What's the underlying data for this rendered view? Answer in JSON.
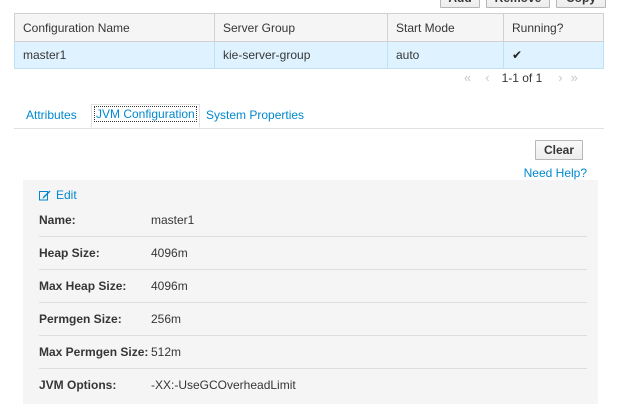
{
  "toolbar": {
    "add_label": "Add",
    "remove_label": "Remove",
    "copy_label": "Copy"
  },
  "table": {
    "headers": [
      "Configuration Name",
      "Server Group",
      "Start Mode",
      "Running?"
    ],
    "rows": [
      {
        "name": "master1",
        "group": "kie-server-group",
        "mode": "auto",
        "running": "✔"
      }
    ]
  },
  "pager": {
    "range": "1-1 of 1"
  },
  "tabs": [
    "Attributes",
    "JVM Configuration",
    "System Properties"
  ],
  "clear_label": "Clear",
  "help_label": "Need Help?",
  "form": {
    "edit_label": "Edit",
    "fields": [
      {
        "label": "Name:",
        "value": "master1"
      },
      {
        "label": "Heap Size:",
        "value": "4096m"
      },
      {
        "label": "Max Heap Size:",
        "value": "4096m"
      },
      {
        "label": "Permgen Size:",
        "value": "256m"
      },
      {
        "label": "Max Permgen Size:",
        "value": "512m"
      },
      {
        "label": "JVM Options:",
        "value": "-XX:-UseGCOverheadLimit"
      }
    ]
  }
}
